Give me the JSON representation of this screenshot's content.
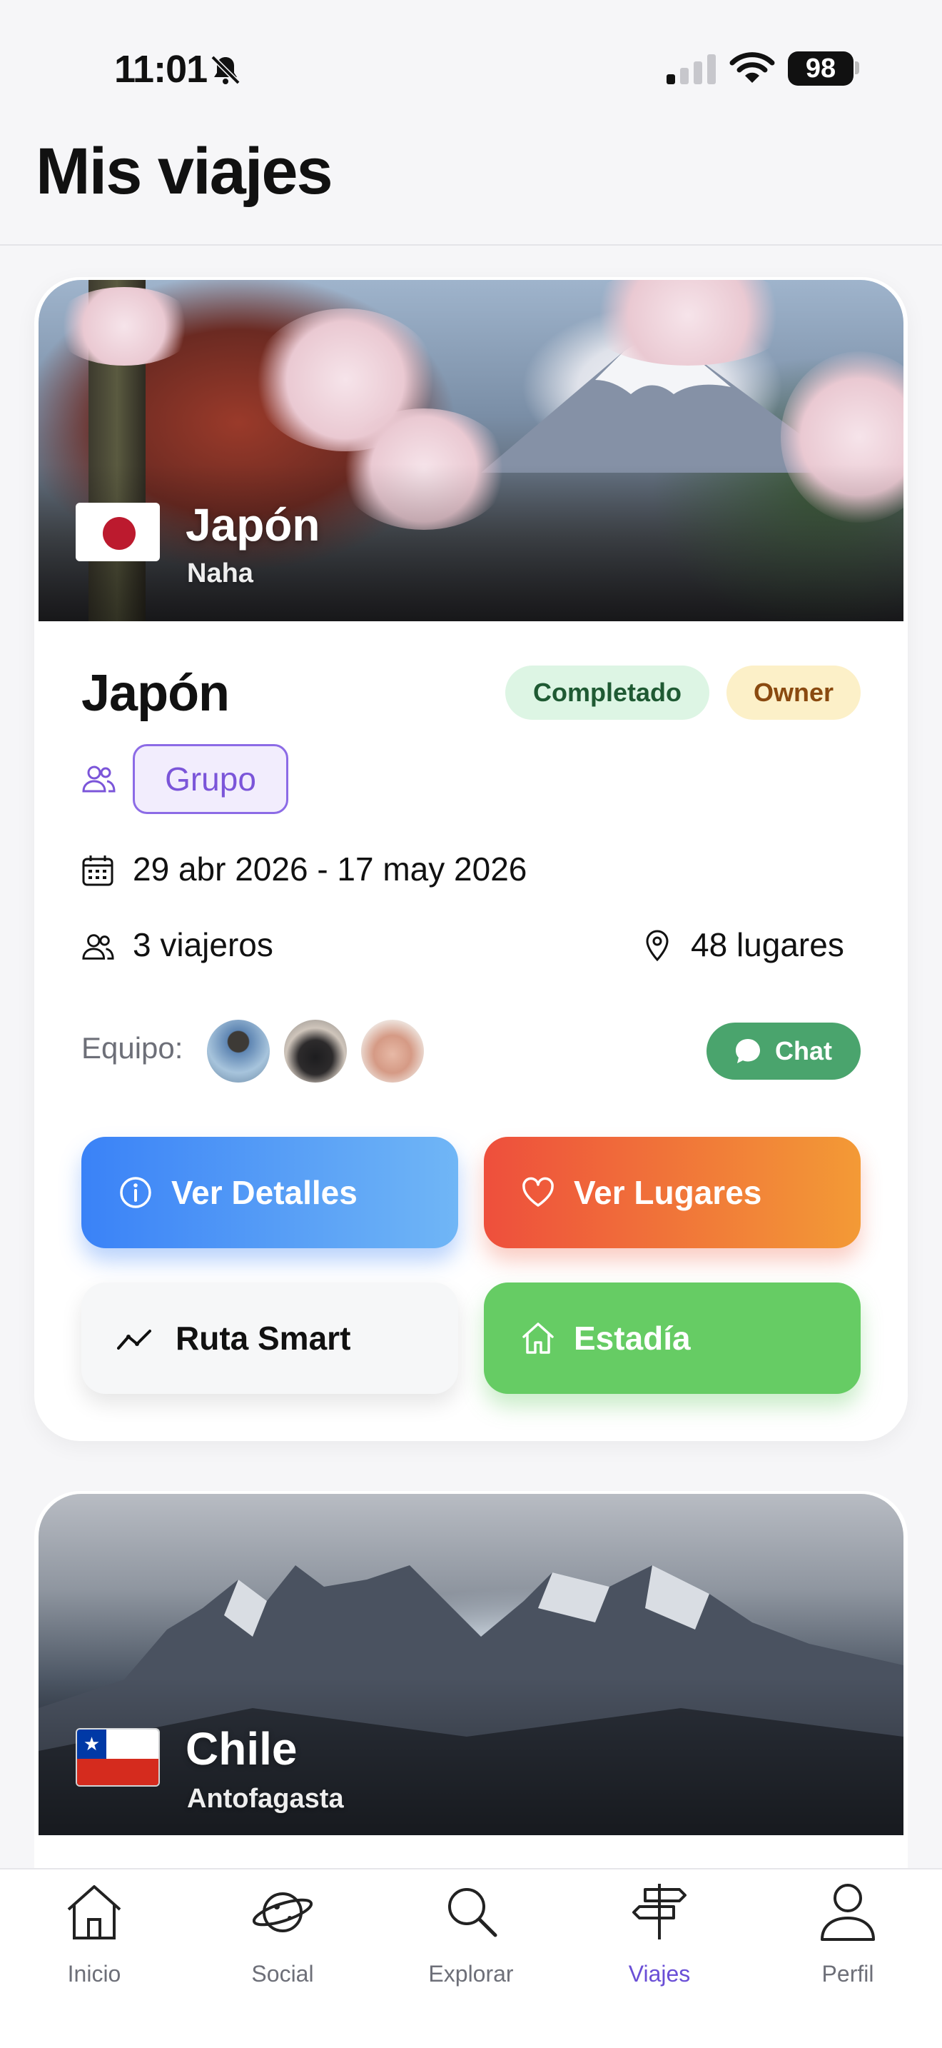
{
  "status_bar": {
    "time": "11:01",
    "battery": "98"
  },
  "header": {
    "title": "Mis viajes"
  },
  "trips": [
    {
      "hero_title": "Japón",
      "hero_subtitle": "Naha",
      "name": "Japón",
      "status_badge": "Completado",
      "role_badge": "Owner",
      "type_chip": "Grupo",
      "dates": "29 abr 2026 - 17 may 2026",
      "travelers": "3 viajeros",
      "places": "48 lugares",
      "team_label": "Equipo:",
      "chat_label": "Chat",
      "actions": {
        "details": "Ver Detalles",
        "places": "Ver Lugares",
        "route": "Ruta Smart",
        "stay": "Estadía"
      }
    },
    {
      "hero_title": "Chile",
      "hero_subtitle": "Antofagasta"
    }
  ],
  "tab_bar": {
    "items": [
      {
        "label": "Inicio",
        "icon": "home-icon"
      },
      {
        "label": "Social",
        "icon": "planet-icon"
      },
      {
        "label": "Explorar",
        "icon": "search-icon"
      },
      {
        "label": "Viajes",
        "icon": "signpost-icon",
        "active": true
      },
      {
        "label": "Perfil",
        "icon": "user-icon"
      }
    ]
  },
  "colors": {
    "accent_purple": "#7b55d9",
    "chat_green": "#4aa46d",
    "details_blue": "#3a82f7",
    "places_red": "#ee4f3c",
    "stay_green": "#66cc64"
  }
}
